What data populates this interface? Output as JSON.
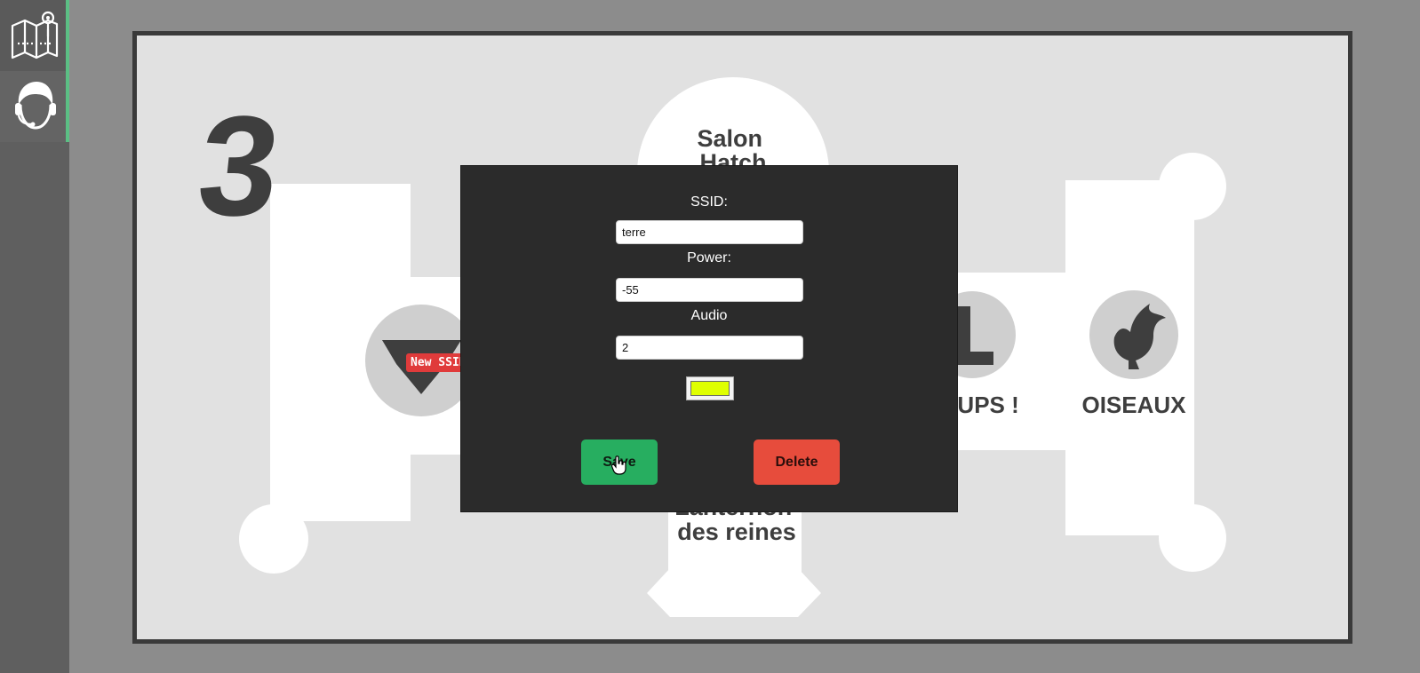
{
  "sidebar": {
    "items": [
      {
        "name": "map",
        "icon": "map-pin-icon",
        "active": true
      },
      {
        "name": "support",
        "icon": "headset-agent-icon",
        "active": true
      }
    ],
    "accent_color": "#5bbf84"
  },
  "map": {
    "floor_number": "3",
    "rooms": [
      {
        "label_lines": [
          "Salon",
          "Hatch"
        ]
      },
      {
        "label_lines": [
          "Lanternon",
          "des reines"
        ]
      },
      {
        "label": "OUPS !"
      },
      {
        "label": "OISEAUX"
      }
    ],
    "ssid_tag": "New SSID",
    "ssid_tag_color": "#e03b3b"
  },
  "modal": {
    "ssid_label": "SSID:",
    "ssid_value": "terre",
    "power_label": "Power:",
    "power_value": "-55",
    "audio_label": "Audio",
    "audio_value": "2",
    "color_value": "#dfff00",
    "save_label": "Save",
    "delete_label": "Delete"
  },
  "colors": {
    "save": "#27ae60",
    "delete": "#e74c3c",
    "modal_bg": "#2b2b2b"
  }
}
